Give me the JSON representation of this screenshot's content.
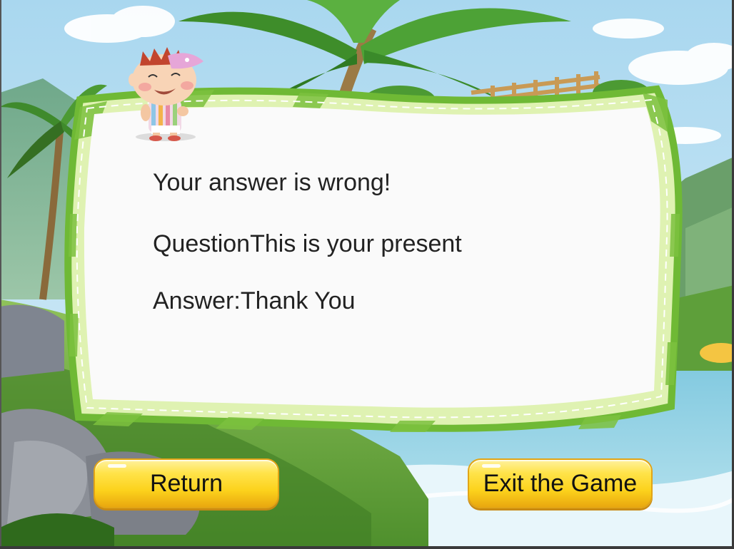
{
  "dialog": {
    "result": "Your answer is wrong!",
    "question": "QuestionThis is your present",
    "answer": "Answer:Thank You"
  },
  "buttons": {
    "return_label": "Return",
    "exit_label": "Exit the Game"
  },
  "colors": {
    "sky": "#bfe2f3",
    "panel_border_light": "#d9f0a6",
    "panel_border_dark": "#6fb935",
    "panel_bg": "#fafafa",
    "button_yellow": "#fcd21c"
  }
}
